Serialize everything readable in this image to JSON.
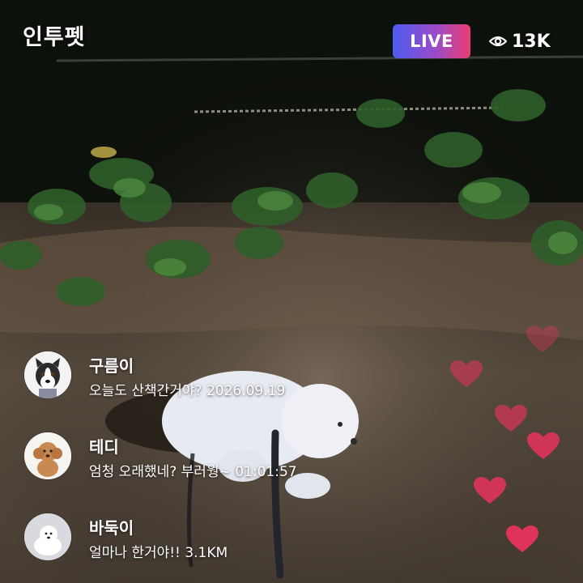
{
  "header": {
    "app_title": "인투펫",
    "live_label": "LIVE",
    "viewer_count": "13K"
  },
  "comments": [
    {
      "name": "구름이",
      "text": "오늘도 산책간거야? 2026.09.19",
      "avatar": "dog-avatar-husky"
    },
    {
      "name": "테디",
      "text": "엄청 오래했네? 부러웡~ 01:01:57",
      "avatar": "dog-avatar-poodle"
    },
    {
      "name": "바둑이",
      "text": "얼마나 한거야!! 3.1KM",
      "avatar": "dog-avatar-white"
    }
  ],
  "colors": {
    "live_gradient_start": "#4e5cf0",
    "live_gradient_end": "#ea3d72",
    "heart": "#e8335f"
  },
  "icons": {
    "viewers": "eye-icon",
    "reaction": "heart-icon"
  }
}
